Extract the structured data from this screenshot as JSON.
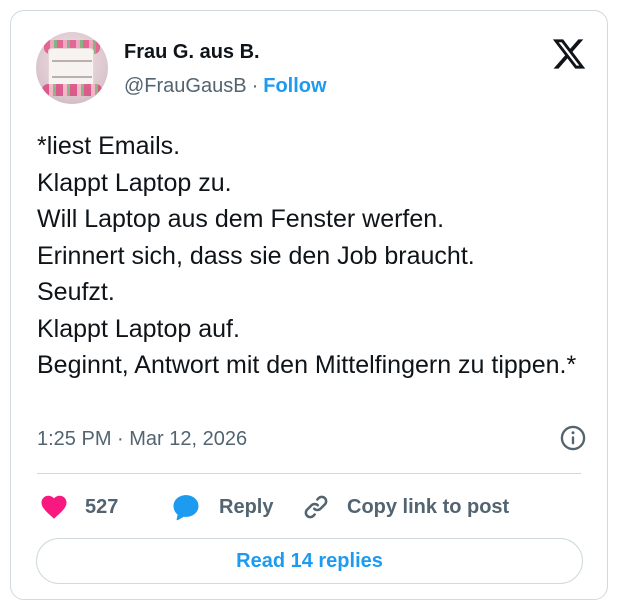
{
  "author": {
    "display_name": "Frau G. aus B.",
    "handle": "@FrauGausB",
    "separator": "·",
    "follow_label": "Follow",
    "avatar_icon": "avatar-photo-mug"
  },
  "platform_icon": "x-logo-icon",
  "tweet": {
    "text": "*liest Emails.\nKlappt Laptop zu.\nWill Laptop aus dem Fenster werfen.\nErinnert sich, dass sie den Job braucht.\nSeufzt.\nKlappt Laptop auf.\nBeginnt, Antwort mit den Mittelfingern zu tippen.*",
    "timestamp": "1:25 PM · Mar 12, 2026"
  },
  "actions": {
    "like_count": "527",
    "reply_label": "Reply",
    "copy_label": "Copy link to post"
  },
  "read_replies_label": "Read 14 replies",
  "colors": {
    "accent": "#1d9bf0",
    "like": "#f91880",
    "text": "#0f1419",
    "muted": "#536471",
    "border": "#cfd9de"
  }
}
